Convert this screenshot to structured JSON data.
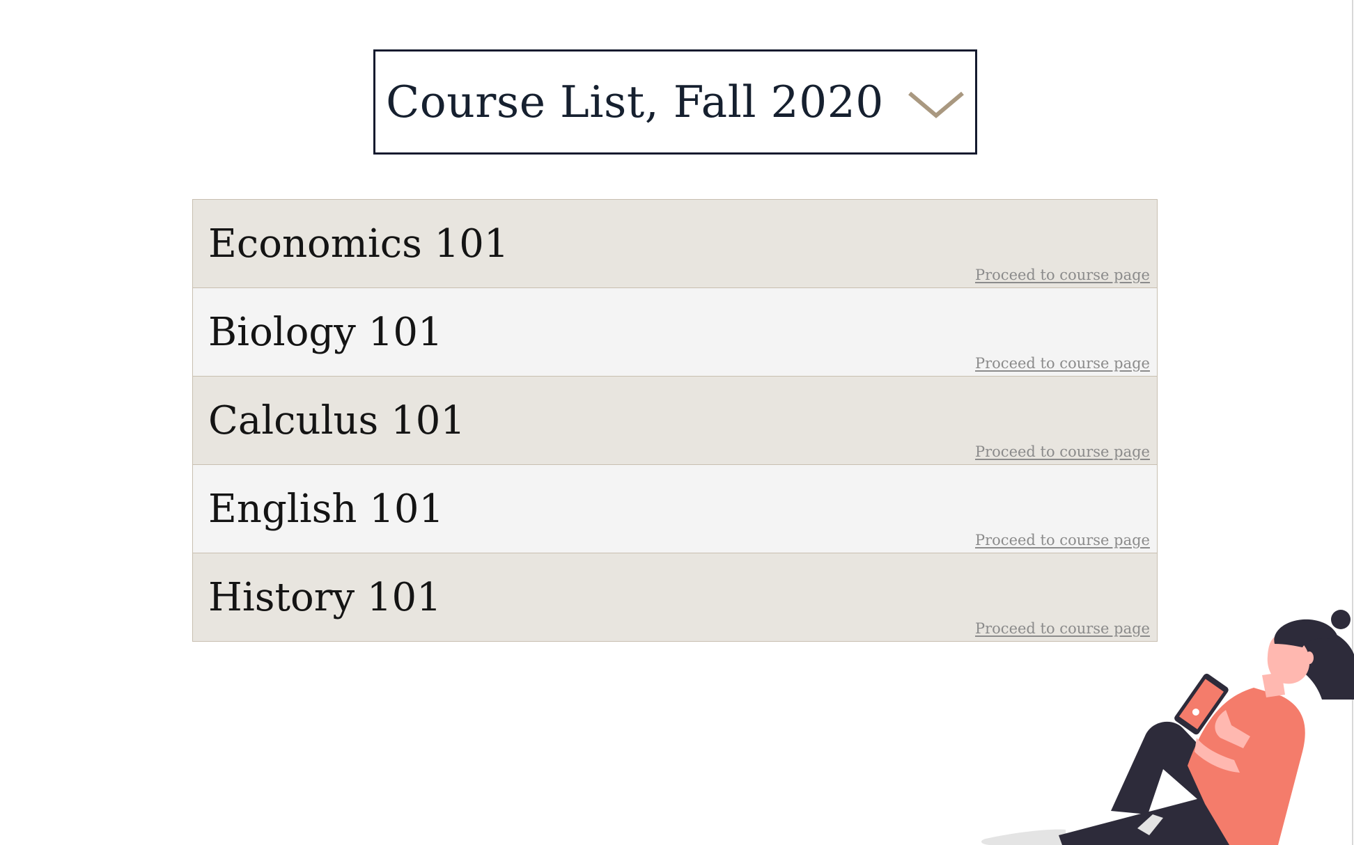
{
  "header": {
    "dropdown_title": "Course List, Fall 2020",
    "dropdown_icon": "chevron-down-icon"
  },
  "courses": [
    {
      "name": "Economics 101",
      "link_label": "Proceed to course page"
    },
    {
      "name": "Biology 101",
      "link_label": "Proceed to course page"
    },
    {
      "name": "Calculus 101",
      "link_label": "Proceed to course page"
    },
    {
      "name": "English 101",
      "link_label": "Proceed to course page"
    },
    {
      "name": "History 101",
      "link_label": "Proceed to course page"
    }
  ],
  "illustration": {
    "name": "woman-reading-phone-illustration"
  },
  "colors": {
    "accent": "#a99880",
    "dropdown_border": "#141a2e",
    "row_dark": "#e8e5df",
    "row_light": "#f4f4f4",
    "row_border": "#c8bfb0",
    "link_text": "#8b8b8b",
    "illustration_shirt": "#f47c6b",
    "illustration_dark": "#2d2b3a",
    "illustration_skin": "#ffb8b0"
  }
}
